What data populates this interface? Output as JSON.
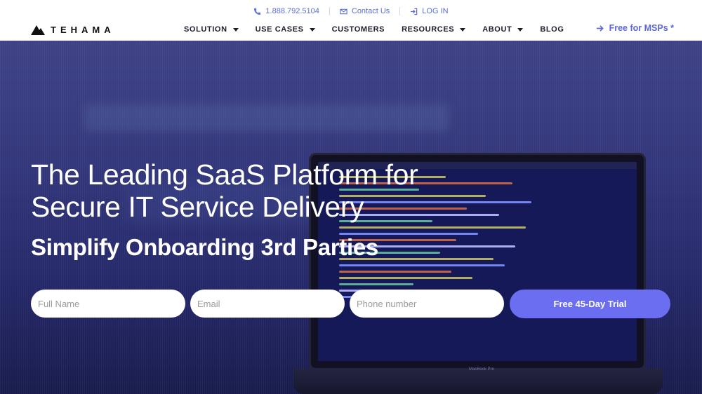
{
  "topbar": {
    "phone": "1.888.792.5104",
    "contact": "Contact Us",
    "login": "LOG IN"
  },
  "logo": {
    "text": "TEHAMA"
  },
  "nav": {
    "items": [
      {
        "label": "SOLUTION",
        "has_dropdown": true
      },
      {
        "label": "USE CASES",
        "has_dropdown": true
      },
      {
        "label": "CUSTOMERS",
        "has_dropdown": false
      },
      {
        "label": "RESOURCES",
        "has_dropdown": true
      },
      {
        "label": "ABOUT",
        "has_dropdown": true
      },
      {
        "label": "BLOG",
        "has_dropdown": false
      }
    ],
    "msp_link": "Free for MSPs *"
  },
  "hero": {
    "headline": "The Leading SaaS Platform for Secure IT Service Delivery",
    "subheadline": "Simplify Onboarding 3rd Parties",
    "laptop_label": "MacBook Pro"
  },
  "form": {
    "full_name_placeholder": "Full Name",
    "email_placeholder": "Email",
    "phone_placeholder": "Phone number",
    "submit_label": "Free 45-Day Trial"
  },
  "colors": {
    "accent": "#5b67e0",
    "cta": "#6b6ef0",
    "nav_text": "#1b1d2b",
    "hero_overlay": "#3a3f7e"
  },
  "icons": {
    "phone": "phone-icon",
    "contact": "envelope-icon",
    "login": "login-icon",
    "msp": "arrow-right-icon",
    "logo": "mountain-logo-icon"
  }
}
